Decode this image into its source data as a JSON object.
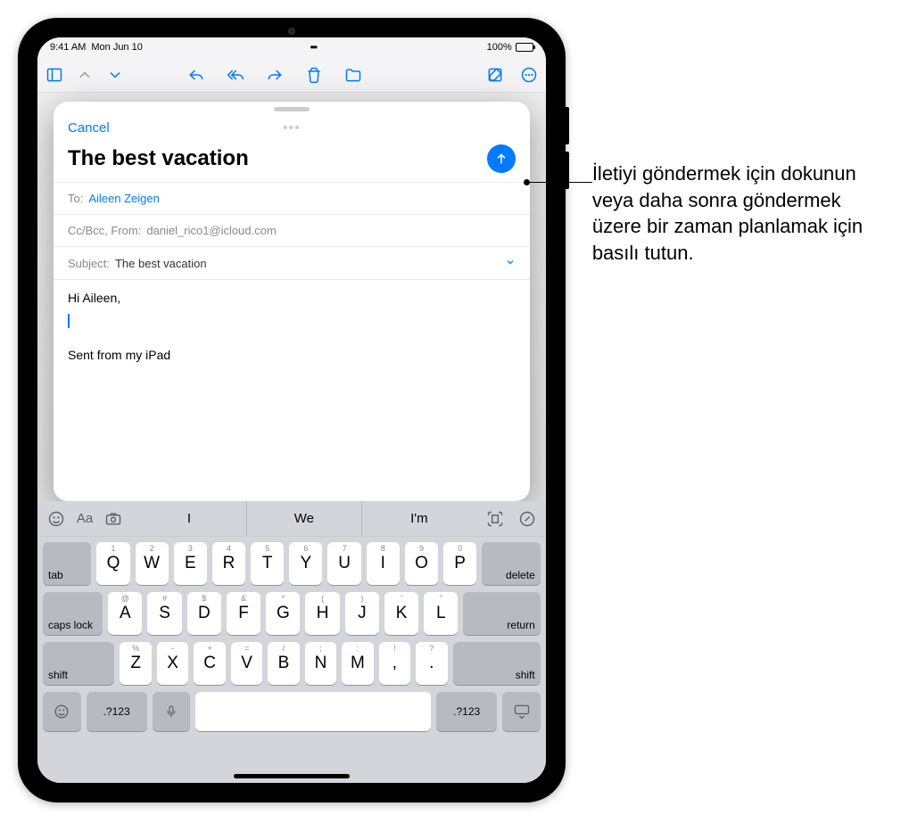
{
  "status": {
    "time": "9:41 AM",
    "date": "Mon Jun 10",
    "battery_pct": "100%"
  },
  "compose": {
    "cancel": "Cancel",
    "title": "The best vacation",
    "to_label": "To:",
    "to_value": "Aileen Zeigen",
    "ccbcc_from_label": "Cc/Bcc, From:",
    "from_value": "daniel_rico1@icloud.com",
    "subject_label": "Subject:",
    "subject_value": "The best vacation",
    "body_greeting": "Hi Aileen,",
    "signature": "Sent from my iPad"
  },
  "keyboard": {
    "suggestions": [
      "I",
      "We",
      "I'm"
    ],
    "row1": [
      {
        "alt": "1",
        "main": "Q"
      },
      {
        "alt": "2",
        "main": "W"
      },
      {
        "alt": "3",
        "main": "E"
      },
      {
        "alt": "4",
        "main": "R"
      },
      {
        "alt": "5",
        "main": "T"
      },
      {
        "alt": "6",
        "main": "Y"
      },
      {
        "alt": "7",
        "main": "U"
      },
      {
        "alt": "8",
        "main": "I"
      },
      {
        "alt": "9",
        "main": "O"
      },
      {
        "alt": "0",
        "main": "P"
      }
    ],
    "row2": [
      {
        "alt": "@",
        "main": "A"
      },
      {
        "alt": "#",
        "main": "S"
      },
      {
        "alt": "$",
        "main": "D"
      },
      {
        "alt": "&",
        "main": "F"
      },
      {
        "alt": "*",
        "main": "G"
      },
      {
        "alt": "(",
        "main": "H"
      },
      {
        "alt": ")",
        "main": "J"
      },
      {
        "alt": "'",
        "main": "K"
      },
      {
        "alt": "\"",
        "main": "L"
      }
    ],
    "row3": [
      {
        "alt": "%",
        "main": "Z"
      },
      {
        "alt": "-",
        "main": "X"
      },
      {
        "alt": "+",
        "main": "C"
      },
      {
        "alt": "=",
        "main": "V"
      },
      {
        "alt": "/",
        "main": "B"
      },
      {
        "alt": ";",
        "main": "N"
      },
      {
        "alt": ":",
        "main": "M"
      },
      {
        "alt": "!",
        "main": ","
      },
      {
        "alt": "?",
        "main": "."
      }
    ],
    "tab": "tab",
    "delete": "delete",
    "caps": "caps lock",
    "return": "return",
    "shift": "shift",
    "numsym": ".?123",
    "aa": "Aa"
  },
  "callout": {
    "text": "İletiyi göndermek için dokunun veya daha sonra göndermek üzere bir zaman planlamak için basılı tutun."
  }
}
